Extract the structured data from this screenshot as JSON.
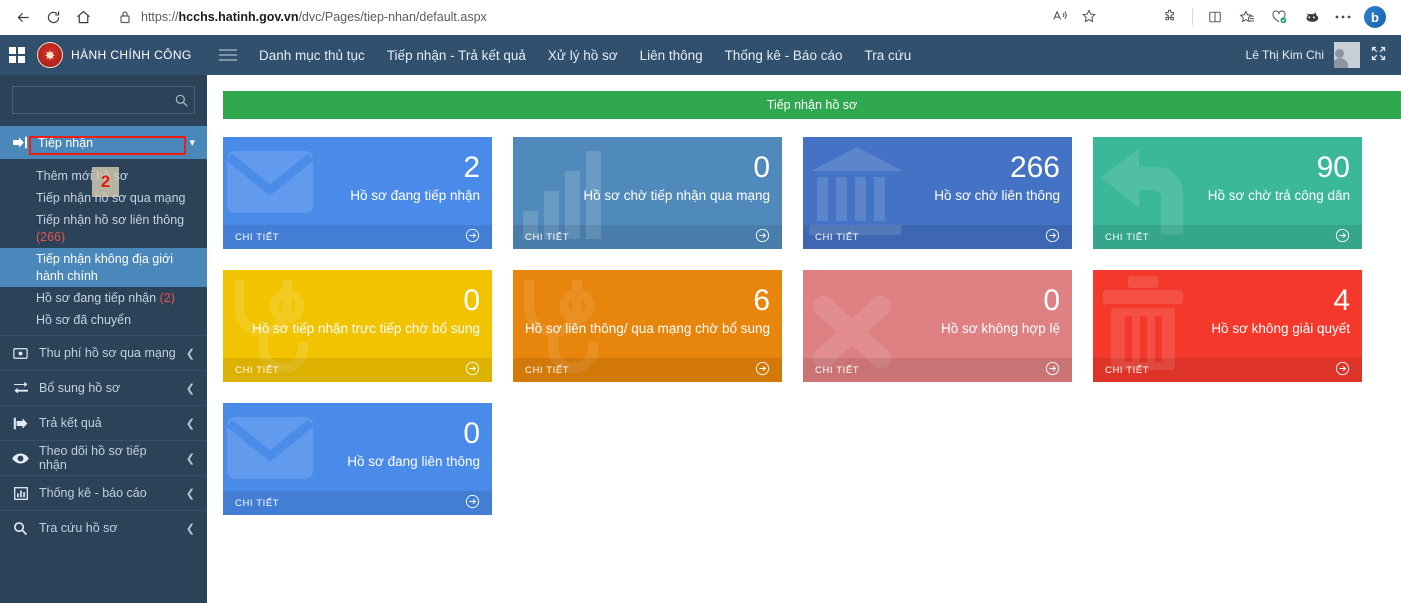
{
  "browser": {
    "url_host": "hcchs.hatinh.gov.vn",
    "url_rest": "/dvc/Pages/tiep-nhan/default.aspx",
    "url_scheme": "https://",
    "back_label": "back-arrow",
    "reload_label": "reload",
    "home_label": "home",
    "icons": [
      "read-aloud-icon",
      "favorite-icon",
      "split-screen-icon",
      "collections-icon",
      "favorites-bar-icon",
      "browser-essentials-icon",
      "extension-icon",
      "more-icon",
      "bing-chat-icon"
    ]
  },
  "header": {
    "brand": "HÀNH CHÍNH CÔNG",
    "nav": [
      "Danh mục thủ tục",
      "Tiếp nhận - Trả kết quả",
      "Xử lý hồ sơ",
      "Liên thông",
      "Thống kê - Báo cáo",
      "Tra cứu"
    ],
    "user": "Lê Thị Kim Chi"
  },
  "sidebar": {
    "search_placeholder": "",
    "search_value": "",
    "group": {
      "label": "Tiếp nhận",
      "icon": "sign-in-icon",
      "expanded": true,
      "items": [
        {
          "label": "Thêm mới hồ sơ",
          "count": "",
          "highlighted": false
        },
        {
          "label": "Tiếp nhận hồ sơ qua mạng",
          "count": "",
          "highlighted": false
        },
        {
          "label": "Tiếp nhận hồ sơ liên thông",
          "count": "(266)",
          "highlighted": false
        },
        {
          "label": "Tiếp nhận không địa giới hành chính",
          "count": "",
          "highlighted": true
        },
        {
          "label": "Hồ sơ đang tiếp nhận",
          "count": "(2)",
          "highlighted": false
        },
        {
          "label": "Hồ sơ đã chuyển",
          "count": "",
          "highlighted": false
        }
      ]
    },
    "items": [
      {
        "label": "Thu phí hồ sơ qua mạng",
        "icon": "money-icon"
      },
      {
        "label": "Bổ sung hồ sơ",
        "icon": "exchange-icon"
      },
      {
        "label": "Trả kết quả",
        "icon": "sign-out-icon"
      },
      {
        "label": "Theo dõi hồ sơ tiếp nhận",
        "icon": "eye-icon"
      },
      {
        "label": "Thống kê - báo cáo",
        "icon": "bar-chart-icon"
      },
      {
        "label": "Tra cứu hồ sơ",
        "icon": "search-icon"
      }
    ]
  },
  "annotation": {
    "step_number": "2",
    "box_color": "#ef1d12",
    "target_label": "Tiếp nhận hồ sơ qua mạng"
  },
  "main": {
    "banner": "Tiếp nhận hồ sơ",
    "detail_label": "CHI TIẾT",
    "tiles": [
      {
        "value": "2",
        "label": "Hồ sơ đang tiếp nhận",
        "color": "#4a8bea",
        "icon": "envelope-icon"
      },
      {
        "value": "0",
        "label": "Hồ sơ chờ tiếp nhận qua mạng",
        "color": "#5089bb",
        "icon": "bar-chart-icon"
      },
      {
        "value": "266",
        "label": "Hồ sơ chờ liên thông",
        "color": "#4472c4",
        "icon": "bank-icon"
      },
      {
        "value": "90",
        "label": "Hồ sơ chờ trả công dân",
        "color": "#3bb79a",
        "icon": "reply-arrow-icon"
      },
      {
        "value": "0",
        "label": "Hồ sơ tiếp nhận trực tiếp chờ bổ sung",
        "color": "#f2c300",
        "icon": "stethoscope-icon"
      },
      {
        "value": "6",
        "label": "Hồ sơ liên thông/ qua mạng chờ bổ sung",
        "color": "#e8850c",
        "icon": "stethoscope-icon"
      },
      {
        "value": "0",
        "label": "Hồ sơ không hợp lệ",
        "color": "#df8082",
        "icon": "times-icon"
      },
      {
        "value": "4",
        "label": "Hồ sơ không giải quyết",
        "color": "#f4392c",
        "icon": "trash-icon"
      },
      {
        "value": "0",
        "label": "Hồ sơ đang liên thông",
        "color": "#4a8bea",
        "icon": "envelope-icon"
      }
    ]
  }
}
